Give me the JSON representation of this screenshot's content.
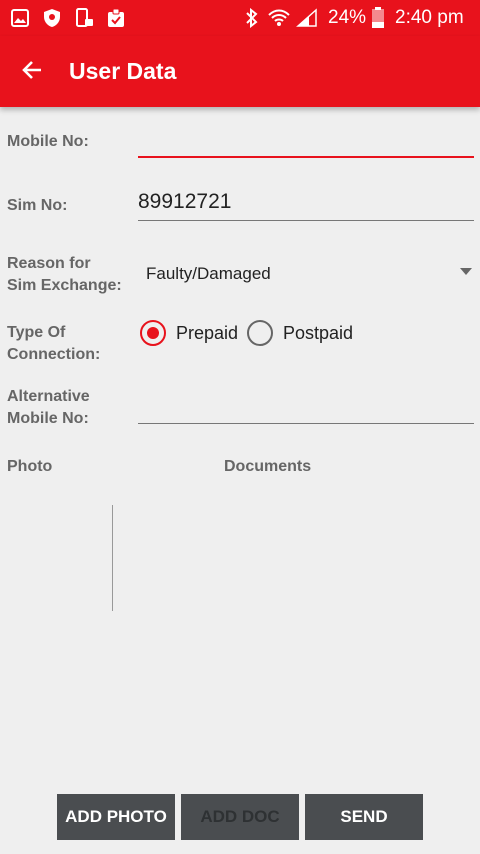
{
  "status_bar": {
    "battery": "24%",
    "time": "2:40 pm",
    "icons": [
      "gallery-icon",
      "shield-icon",
      "phone-lock-icon",
      "clipboard-icon",
      "bluetooth-icon",
      "wifi-icon",
      "signal-icon",
      "battery-icon"
    ]
  },
  "appbar": {
    "title": "User Data",
    "back_icon": "arrow-left-icon"
  },
  "form": {
    "mobile_label": "Mobile No:",
    "mobile_value": "",
    "sim_label": "Sim No:",
    "sim_value": "89912721",
    "reason_label_line1": "Reason for",
    "reason_label_line2": "Sim Exchange:",
    "reason_value": "Faulty/Damaged",
    "connection_label_line1": "Type Of",
    "connection_label_line2": "Connection:",
    "connection_options": [
      "Prepaid",
      "Postpaid"
    ],
    "connection_selected": "Prepaid",
    "alt_label_line1": "Alternative",
    "alt_label_line2": "Mobile No:",
    "alt_value": ""
  },
  "attachments": {
    "photo_label": "Photo",
    "documents_label": "Documents"
  },
  "buttons": {
    "add_photo": "ADD PHOTO",
    "add_doc": "ADD DOC",
    "send": "SEND"
  },
  "colors": {
    "accent": "#e8121c",
    "background": "#efefef",
    "button": "#4a4d50"
  }
}
